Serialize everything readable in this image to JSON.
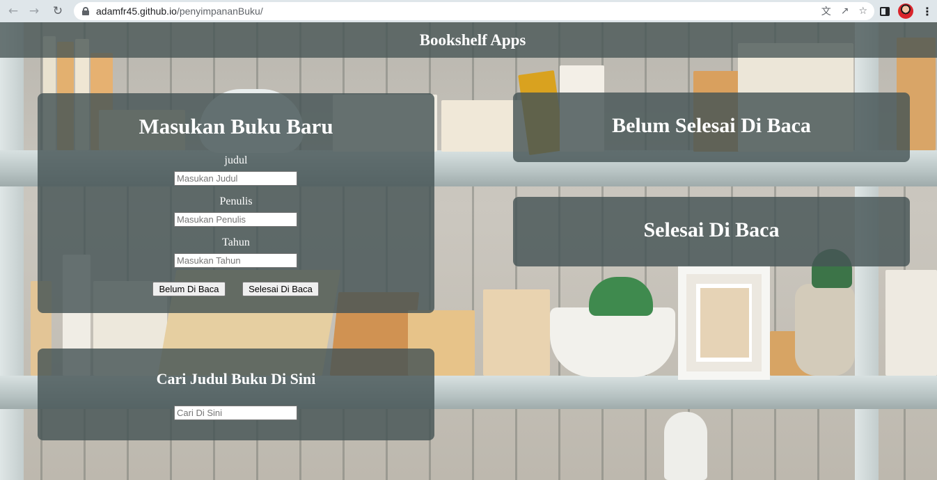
{
  "browser": {
    "url_host": "adamfr45.github.io",
    "url_path": "/penyimpananBuku/",
    "back_icon": "arrow-left",
    "forward_icon": "arrow-right",
    "reload_icon": "reload",
    "translate_icon": "translate",
    "share_icon": "share",
    "star_icon": "star",
    "menu_icon": "kebab"
  },
  "header": {
    "title": "Bookshelf Apps"
  },
  "input_section": {
    "heading": "Masukan Buku Baru",
    "title_label": "judul",
    "title_placeholder": "Masukan Judul",
    "author_label": "Penulis",
    "author_placeholder": "Masukan Penulis",
    "year_label": "Tahun",
    "year_placeholder": "Masukan Tahun",
    "unread_button": "Belum Di Baca",
    "read_button": "Selesai Di Baca"
  },
  "search_section": {
    "heading": "Cari Judul Buku Di Sini",
    "placeholder": "Cari Di Sini"
  },
  "incomplete_section": {
    "heading": "Belum Selesai Di Baca"
  },
  "complete_section": {
    "heading": "Selesai Di Baca"
  }
}
